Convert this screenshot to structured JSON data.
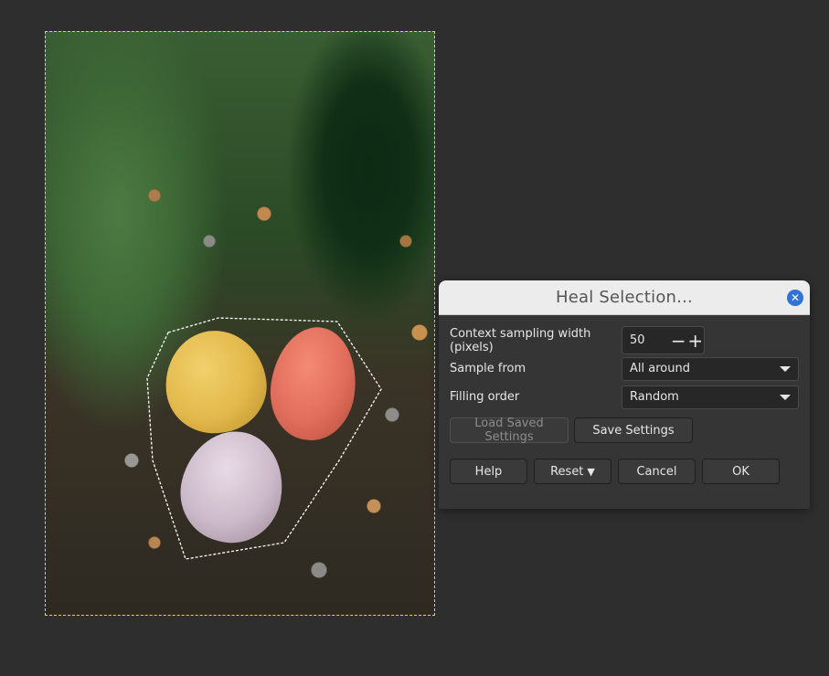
{
  "dialog": {
    "title": "Heal Selection...",
    "close_icon": "close-icon",
    "context_label": "Context sampling width (pixels)",
    "context_value": "50",
    "decrement": "−",
    "increment": "+",
    "sample_from_label": "Sample from",
    "sample_from_value": "All around",
    "filling_order_label": "Filling order",
    "filling_order_value": "Random",
    "load_settings": "Load Saved Settings",
    "save_settings": "Save Settings",
    "help": "Help",
    "reset": "Reset",
    "cancel": "Cancel",
    "ok": "OK"
  },
  "colors": {
    "canvas_bg": "#2e2e2e",
    "dialog_bg": "#353535",
    "titlebar_bg": "#ececec",
    "close_accent": "#2f73d9",
    "selection_dash": "#e8e000"
  }
}
